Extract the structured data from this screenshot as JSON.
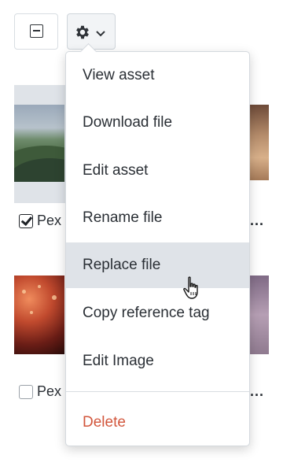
{
  "toolbar": {
    "select_icon": "minus-checkbox-icon",
    "gear_icon": "gear-icon",
    "chevron_icon": "chevron-down-icon"
  },
  "grid": {
    "items": [
      {
        "name_fragment": "Pex",
        "checked": true,
        "more": "..."
      },
      {
        "name_fragment": "Pex",
        "checked": false,
        "more": "..."
      }
    ]
  },
  "menu": {
    "items": [
      {
        "label": "View asset"
      },
      {
        "label": "Download file"
      },
      {
        "label": "Edit asset"
      },
      {
        "label": "Rename file"
      },
      {
        "label": "Replace file",
        "hovered": true
      },
      {
        "label": "Copy reference tag"
      },
      {
        "label": "Edit Image"
      }
    ],
    "danger_item": {
      "label": "Delete"
    }
  },
  "colors": {
    "danger": "#d2563c",
    "hover": "#dfe3e8",
    "text": "#2a2f35"
  }
}
